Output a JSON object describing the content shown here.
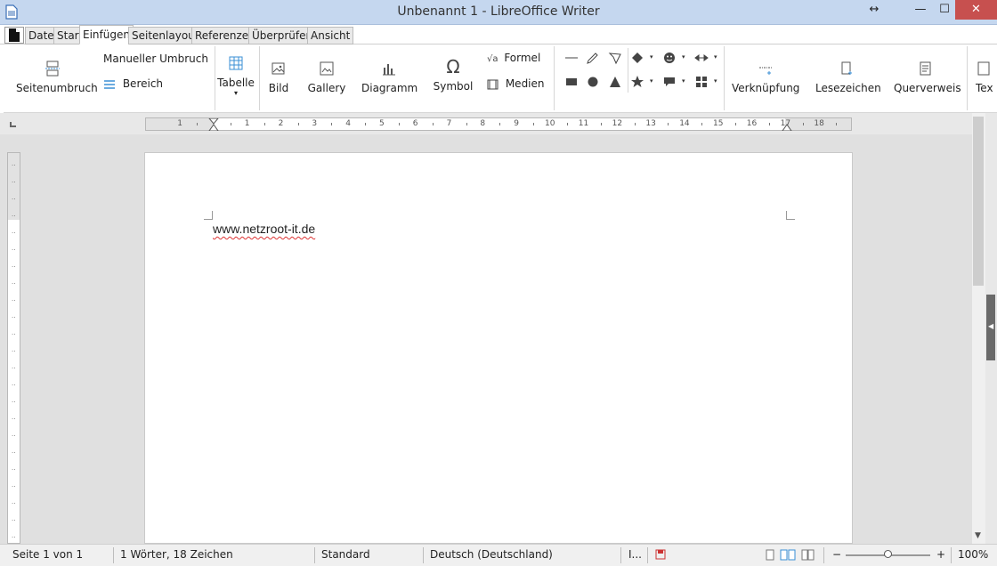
{
  "window": {
    "title": "Unbenannt 1 - LibreOffice Writer",
    "restore_glyph": "↔",
    "minimize_glyph": "—",
    "maximize_glyph": "☐",
    "close_glyph": "✕"
  },
  "tabs": [
    {
      "label": "Datei"
    },
    {
      "label": "Start"
    },
    {
      "label": "Einfügen",
      "active": true
    },
    {
      "label": "Seitenlayout"
    },
    {
      "label": "Referenzen"
    },
    {
      "label": "Überprüfen"
    },
    {
      "label": "Ansicht"
    }
  ],
  "ribbon": {
    "seitenumbruch": "Seitenumbruch",
    "manueller_umbruch": "Manueller Umbruch",
    "bereich": "Bereich",
    "tabelle": "Tabelle",
    "tabelle_arrow": "▾",
    "bild": "Bild",
    "gallery": "Gallery",
    "diagramm": "Diagramm",
    "symbol": "Symbol",
    "symbol_glyph": "Ω",
    "formel": "Formel",
    "formel_glyph": "√a",
    "medien": "Medien",
    "verknuepfung": "Verknüpfung",
    "lesezeichen": "Lesezeichen",
    "querverweis": "Querverweis",
    "text_partial": "Tex",
    "dropdown_glyph": "▾"
  },
  "ruler": {
    "numbers": [
      "1",
      "1",
      "2",
      "3",
      "4",
      "5",
      "6",
      "7",
      "8",
      "9",
      "10",
      "11",
      "12",
      "13",
      "14",
      "15",
      "16",
      "17",
      "18"
    ]
  },
  "document": {
    "text": "www.netzroot-it.de"
  },
  "statusbar": {
    "page": "Seite 1 von 1",
    "words": "1 Wörter, 18 Zeichen",
    "style": "Standard",
    "language": "Deutsch (Deutschland)",
    "insert_mode": "I...",
    "zoom_minus": "−",
    "zoom_plus": "+",
    "zoom": "100%"
  },
  "colors": {
    "titlebar": "#c5d7ef",
    "close": "#c7504f",
    "accent_icon": "#3a8fd6"
  }
}
